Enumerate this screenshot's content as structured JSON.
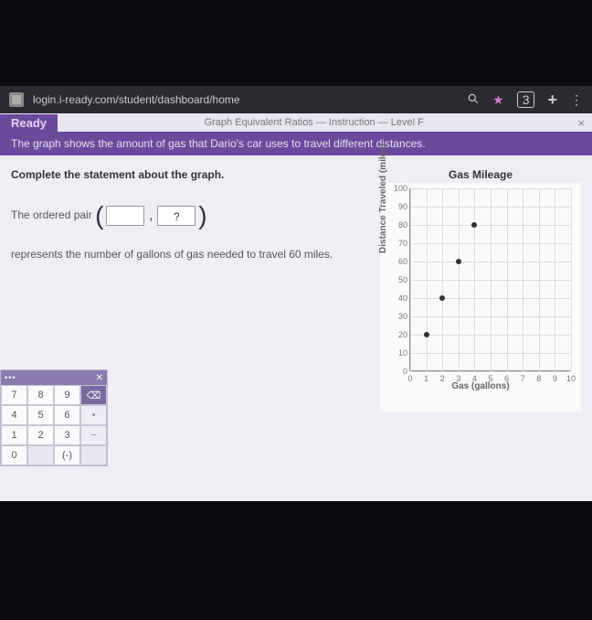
{
  "browser": {
    "url": "login.i-ready.com/student/dashboard/home",
    "tab_count": "3"
  },
  "header": {
    "brand": "Ready",
    "lesson": "Graph Equivalent Ratios — Instruction — Level F",
    "close": "×"
  },
  "problem": {
    "prompt": "The graph shows the amount of gas that Dario's car uses to travel different distances."
  },
  "left": {
    "instruction": "Complete the statement about the graph.",
    "line1_a": "The ordered pair",
    "input1_value": "",
    "input2_value": "?",
    "line2": "represents the number of gallons of gas needed to travel 60 miles."
  },
  "chart_data": {
    "type": "scatter",
    "title": "Gas Mileage",
    "xlabel": "Gas (gallons)",
    "ylabel": "Distance Traveled (miles)",
    "xlim": [
      0,
      10
    ],
    "ylim": [
      0,
      100
    ],
    "xticks": [
      0,
      1,
      2,
      3,
      4,
      5,
      6,
      7,
      8,
      9,
      10
    ],
    "yticks": [
      0,
      10,
      20,
      30,
      40,
      50,
      60,
      70,
      80,
      90,
      100
    ],
    "points": [
      {
        "x": 1,
        "y": 20
      },
      {
        "x": 2,
        "y": 40
      },
      {
        "x": 3,
        "y": 60
      },
      {
        "x": 4,
        "y": 80
      }
    ]
  },
  "keypad": {
    "rows": [
      [
        "7",
        "8",
        "9",
        "⌫"
      ],
      [
        "4",
        "5",
        "6",
        "•"
      ],
      [
        "1",
        "2",
        "3",
        "−"
      ],
      [
        "0",
        "",
        "(-)",
        ""
      ]
    ]
  }
}
